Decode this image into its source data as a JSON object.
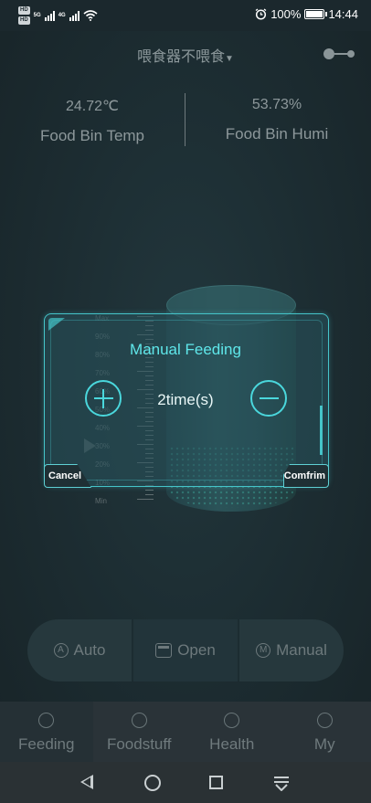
{
  "status_bar": {
    "left_chips": [
      "HD",
      "HD"
    ],
    "left_tiny": [
      "5G",
      "4G"
    ],
    "alarm_icon": "alarm-clock-icon",
    "battery_text": "100%",
    "battery_level": 1.0,
    "time": "14:44"
  },
  "header": {
    "device_title": "喂食器不喂食",
    "dropdown_icon": "dropdown-triangle-icon",
    "toggle_icon": "toggle-icon"
  },
  "stats": {
    "temp_value": "24.72℃",
    "temp_label": "Food Bin Temp",
    "humi_value": "53.73%",
    "humi_label": "Food Bin Humi"
  },
  "scale": {
    "labels": [
      "Max",
      "90%",
      "80%",
      "70%",
      "60%",
      "50%",
      "40%",
      "30%",
      "20%",
      "10%",
      "Min"
    ]
  },
  "modal": {
    "title": "Manual Feeding",
    "value": "2time(s)",
    "cancel_label": "Cancel",
    "confirm_label": "Comfrim"
  },
  "modes": {
    "auto_label": "Auto",
    "open_label": "Open",
    "manual_label": "Manual"
  },
  "tabs": {
    "feeding": "Feeding",
    "foodstuff": "Foodstuff",
    "health": "Health",
    "my": "My"
  },
  "colors": {
    "accent": "#45c4c9",
    "title_text": "#5fe7ea"
  }
}
